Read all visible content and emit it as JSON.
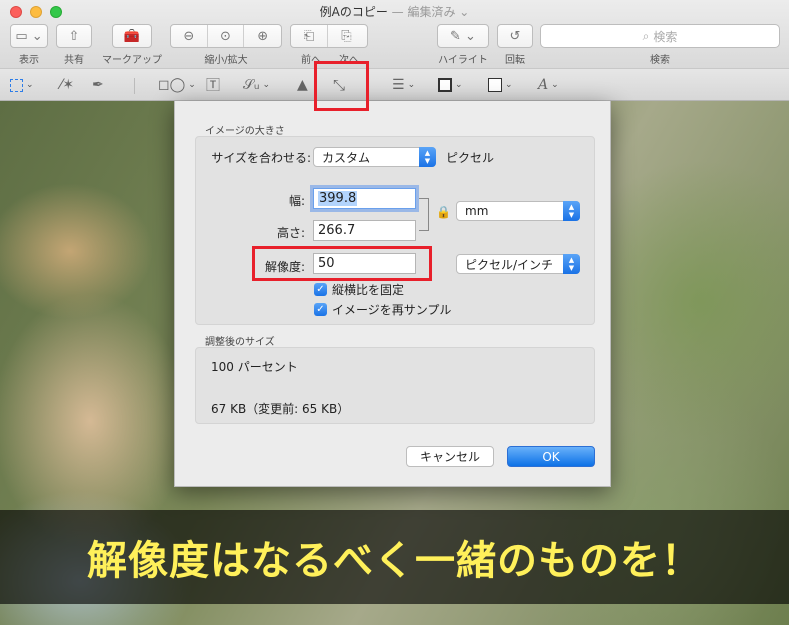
{
  "window": {
    "title": "例Aのコピー",
    "title_suffix": "— 編集済み ⌄"
  },
  "toolbar": {
    "view_label": "表示",
    "share_label": "共有",
    "markup_label": "マークアップ",
    "zoom_label": "縮小/拡大",
    "nav_prev_label": "前へ",
    "nav_next_label": "次へ",
    "highlight_label": "ハイライト",
    "rotate_label": "回転",
    "search_label": "検索",
    "search_placeholder": "検索"
  },
  "dialog": {
    "section_image_size": "イメージの大きさ",
    "fit_label": "サイズを合わせる:",
    "fit_value": "カスタム",
    "fit_unit": "ピクセル",
    "width_label": "幅:",
    "width_value": "399.8",
    "height_label": "高さ:",
    "height_value": "266.7",
    "resolution_label": "解像度:",
    "resolution_value": "50",
    "size_unit": "mm",
    "resolution_unit": "ピクセル/インチ",
    "keep_ratio_label": "縦横比を固定",
    "keep_ratio_checked": true,
    "resample_label": "イメージを再サンプル",
    "resample_checked": true,
    "section_result": "調整後のサイズ",
    "result_percent": "100 パーセント",
    "result_filesize": "67 KB（変更前: 65 KB）",
    "cancel_label": "キャンセル",
    "ok_label": "OK"
  },
  "caption": {
    "text": "解像度はなるべく一緒のものを！"
  },
  "colors": {
    "highlight": "#e8202b",
    "caption_text": "#fff05a",
    "accent": "#1a72e6"
  }
}
